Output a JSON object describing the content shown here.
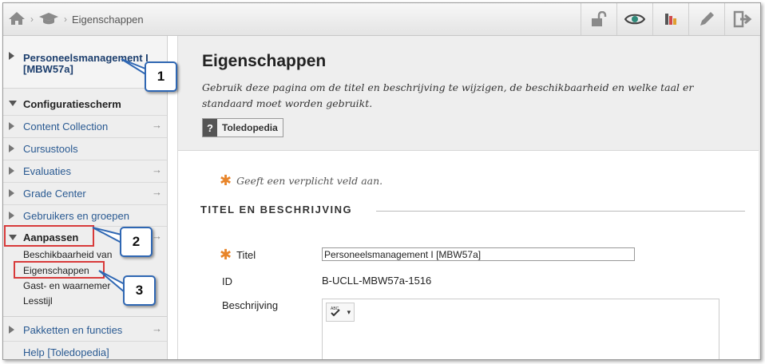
{
  "breadcrumb": {
    "current": "Eigenschappen"
  },
  "toolbar": {
    "icons": [
      "lock-open-icon",
      "eye-icon",
      "palette-icon",
      "pencil-icon",
      "exit-icon"
    ]
  },
  "leftnav": {
    "course_title": "Personeelsmanagement I [MBW57a]",
    "section_header": "Configuratiescherm",
    "items": [
      {
        "label": "Content Collection",
        "arrow": "→"
      },
      {
        "label": "Cursustools",
        "arrow": ""
      },
      {
        "label": "Evaluaties",
        "arrow": "→"
      },
      {
        "label": "Grade Center",
        "arrow": "→"
      },
      {
        "label": "Gebruikers en groepen",
        "arrow": ""
      },
      {
        "label": "Aanpassen",
        "arrow": "→"
      }
    ],
    "sub_items": [
      "Beschikbaarheid van",
      "Eigenschappen",
      "Gast- en waarnemer",
      "Lesstijl"
    ],
    "bottom_items": [
      {
        "label": "Pakketten en functies",
        "arrow": "→"
      },
      {
        "label": "Help [Toledopedia]"
      }
    ]
  },
  "main": {
    "title": "Eigenschappen",
    "description": "Gebruik deze pagina om de titel en beschrijving te wijzigen, de beschikbaarheid en welke taal er standaard moet worden gebruikt.",
    "help_button": {
      "icon_text": "?",
      "label": "Toledopedia"
    },
    "required_note": "Geeft een verplicht veld aan.",
    "section_title": "TITEL EN BESCHRIJVING",
    "fields": {
      "title_label": "Titel",
      "title_value": "Personeelsmanagement I [MBW57a]",
      "id_label": "ID",
      "id_value": "B-UCLL-MBW57a-1516",
      "description_label": "Beschrijving"
    }
  },
  "callouts": [
    "1",
    "2",
    "3"
  ],
  "colors": {
    "callout_border": "#2f67b3",
    "highlight_red": "#d83a3a",
    "required_star": "#e8852a",
    "nav_link": "#2a5a92"
  }
}
